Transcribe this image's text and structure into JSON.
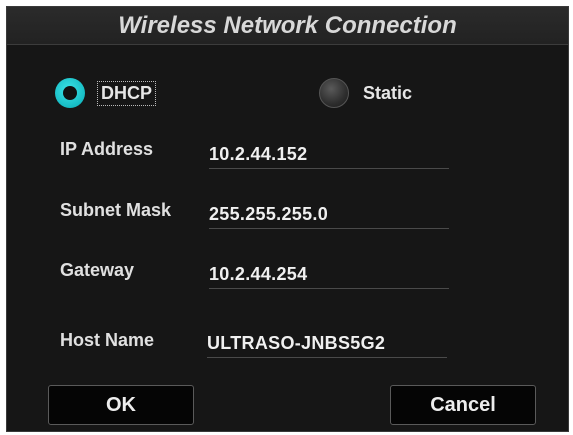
{
  "dialog": {
    "title": "Wireless Network Connection"
  },
  "mode": {
    "selected": "DHCP",
    "options": [
      {
        "label": "DHCP",
        "checked": true
      },
      {
        "label": "Static",
        "checked": false
      }
    ]
  },
  "fields": {
    "ip_address": {
      "label": "IP Address",
      "value": "10.2.44.152"
    },
    "subnet_mask": {
      "label": "Subnet Mask",
      "value": "255.255.255.0"
    },
    "gateway": {
      "label": "Gateway",
      "value": "10.2.44.254"
    },
    "host_name": {
      "label": "Host Name",
      "value": "ULTRASO-JNBS5G2"
    }
  },
  "buttons": {
    "ok_label": "OK",
    "cancel_label": "Cancel"
  },
  "colors": {
    "accent": "#16bcc4",
    "background": "#161616",
    "button_background": "#050505"
  }
}
